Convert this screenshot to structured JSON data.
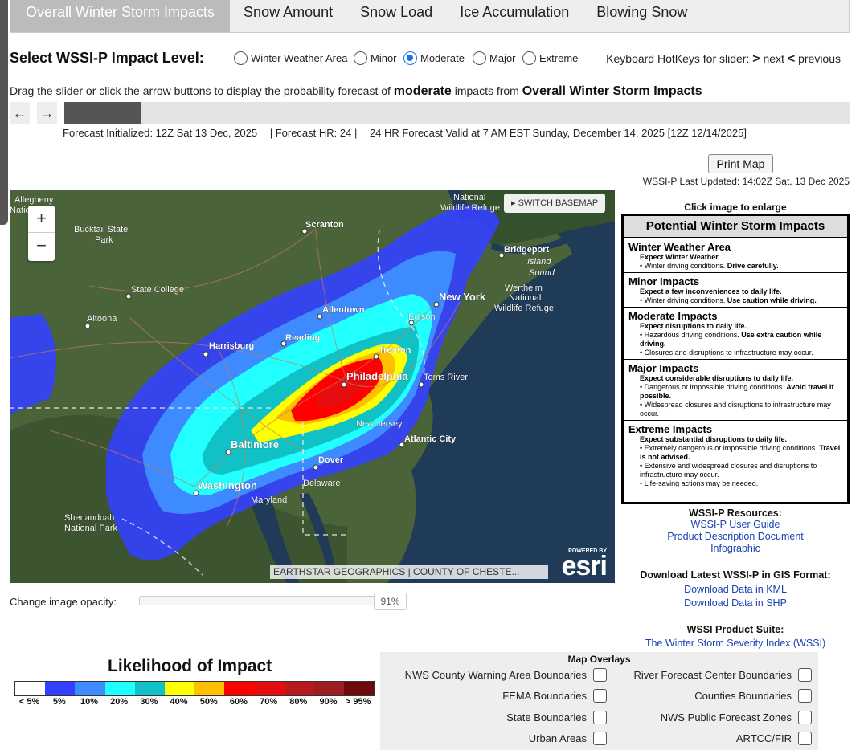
{
  "tabs": [
    {
      "label": "Overall Winter Storm Impacts",
      "active": true
    },
    {
      "label": "Snow Amount",
      "active": false
    },
    {
      "label": "Snow Load",
      "active": false
    },
    {
      "label": "Ice Accumulation",
      "active": false
    },
    {
      "label": "Blowing Snow",
      "active": false
    }
  ],
  "level_selector": {
    "title": "Select WSSI-P Impact Level:",
    "options": [
      {
        "label": "Winter Weather Area",
        "checked": false
      },
      {
        "label": "Minor",
        "checked": false
      },
      {
        "label": "Moderate",
        "checked": true
      },
      {
        "label": "Major",
        "checked": false
      },
      {
        "label": "Extreme",
        "checked": false
      }
    ],
    "hotkeys_prefix": "Keyboard HotKeys for slider:",
    "hotkeys_next_key": ">",
    "hotkeys_next": "next",
    "hotkeys_prev_key": "<",
    "hotkeys_prev": "previous"
  },
  "instructions": {
    "part1": "Drag the slider or click the arrow buttons to display the probability forecast of",
    "level": "moderate",
    "part2": "impacts from",
    "product": "Overall Winter Storm Impacts"
  },
  "slider": {
    "prev_icon": "←",
    "next_icon": "→",
    "fill_fraction": 0.097
  },
  "forecast": {
    "initialized": "Forecast Initialized: 12Z Sat 13 Dec, 2025",
    "hour": "| Forecast HR: 24 |",
    "valid": "24 HR Forecast Valid at 7 AM EST Sunday, December 14, 2025 [12Z 12/14/2025]"
  },
  "print_button": "Print Map",
  "last_updated": "WSSI-P Last Updated: 14:02Z Sat, 13 Dec 2025",
  "map": {
    "zoom_in": "+",
    "zoom_out": "−",
    "switch_basemap": "▸ SWITCH BASEMAP",
    "attribution": "EARTHSTAR GEOGRAPHICS | COUNTY OF CHESTE...",
    "esri_powered": "POWERED BY",
    "esri_logo": "esri",
    "labels": {
      "allegheny": "Allegheny",
      "national_forest": "Natio      rest",
      "bucktail": "Bucktail State",
      "park": "Park",
      "scranton": "Scranton",
      "nwr1": "National",
      "nwr2": "Wildlife Refuge",
      "bridgeport": "Bridgeport",
      "island": "Island",
      "sound": "Sound",
      "state_college": "State College",
      "new_york": "New York",
      "wertheim1": "Wertheim",
      "wertheim2": "National",
      "wertheim3": "Wildlife Refuge",
      "altoona": "Altoona",
      "allentown": "Allentown",
      "edison": "Edison",
      "reading": "Reading",
      "harrisburg": "Harrisburg",
      "trenton": "Trenton",
      "philadelphia": "Philadelphia",
      "toms_river": "Toms River",
      "new_jersey": "New Jersey",
      "atlantic_city": "Atlantic City",
      "baltimore": "Baltimore",
      "dover": "Dover",
      "delaware": "Delaware",
      "washington": "Washington",
      "maryland": "Maryland",
      "shenandoah1": "Shenandoah",
      "shenandoah2": "National Park"
    }
  },
  "opacity": {
    "label": "Change image opacity:",
    "value": "91%",
    "fraction": 0.91
  },
  "legend": {
    "title": "Likelihood of Impact",
    "colors": [
      "#ffffff",
      "#3340ff",
      "#3d8bff",
      "#22ffff",
      "#10c2c6",
      "#ffff00",
      "#ffc000",
      "#ff0000",
      "#e60d10",
      "#b7191c",
      "#9b1e22",
      "#6f0a0a"
    ],
    "labels": [
      "< 5%",
      "5%",
      "10%",
      "20%",
      "30%",
      "40%",
      "50%",
      "60%",
      "70%",
      "80%",
      "90%",
      "> 95%"
    ]
  },
  "overlays": {
    "title": "Map Overlays",
    "left": [
      "NWS County Warning Area Boundaries",
      "FEMA Boundaries",
      "State Boundaries",
      "Urban Areas"
    ],
    "right": [
      "River Forecast Center Boundaries",
      "Counties Boundaries",
      "NWS Public Forecast Zones",
      "ARTCC/FIR"
    ]
  },
  "impacts_legend": {
    "click_text": "Click image to enlarge",
    "title": "Potential Winter Storm Impacts",
    "items": [
      {
        "heading": "Winter Weather Area",
        "sub": "Expect Winter Weather.",
        "points": [
          [
            "• Winter driving conditions. ",
            "Drive carefully."
          ]
        ]
      },
      {
        "heading": "Minor Impacts",
        "sub": "Expect a few inconveniences to daily life.",
        "points": [
          [
            "• Winter driving conditions. ",
            "Use caution while driving."
          ]
        ]
      },
      {
        "heading": "Moderate Impacts",
        "sub": "Expect disruptions to daily life.",
        "points": [
          [
            "• Hazardous driving conditions. ",
            "Use extra caution while driving."
          ],
          [
            "• Closures and disruptions to infrastructure may occur.",
            ""
          ]
        ]
      },
      {
        "heading": "Major Impacts",
        "sub": "Expect considerable disruptions to daily life.",
        "points": [
          [
            "• Dangerous or impossible driving conditions. ",
            "Avoid travel if possible."
          ],
          [
            "• Widespread closures and disruptions to infrastructure may occur.",
            ""
          ]
        ]
      },
      {
        "heading": "Extreme Impacts",
        "sub": "Expect substantial disruptions to daily life.",
        "points": [
          [
            "• Extremely dangerous or impossible driving conditions. ",
            "Travel is not advised."
          ],
          [
            "• Extensive and widespread closures and disruptions to infrastructure may occur.",
            ""
          ],
          [
            "• Life-saving actions may be needed.",
            ""
          ]
        ]
      }
    ]
  },
  "resources": {
    "title": "WSSI-P Resources:",
    "links": [
      "WSSI-P User Guide",
      "Product Description Document",
      "Infographic"
    ]
  },
  "gis": {
    "title": "Download Latest WSSI-P in GIS Format:",
    "links": [
      "Download Data in KML",
      "Download Data in SHP"
    ]
  },
  "suite": {
    "title": "WSSI Product Suite:",
    "links": [
      "The Winter Storm Severity Index (WSSI)"
    ]
  }
}
